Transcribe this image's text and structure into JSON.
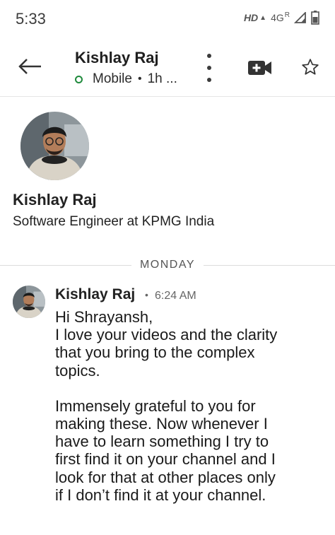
{
  "status_bar": {
    "time": "5:33",
    "network_label": "HD",
    "lte_label": "4G",
    "roaming_label": "R",
    "icons": [
      "signal-icon",
      "battery-icon"
    ]
  },
  "header": {
    "contact_name": "Kishlay Raj",
    "presence_status": "Mobile",
    "last_active": "1h ...",
    "presence_color": "#1f8a3c"
  },
  "profile": {
    "name": "Kishlay Raj",
    "headline": "Software Engineer at KPMG India"
  },
  "day_separator": "MONDAY",
  "message": {
    "sender": "Kishlay Raj",
    "time": "6:24 AM",
    "lines": [
      "Hi Shrayansh,",
      "I love your videos and the clarity",
      "that you bring to the complex",
      "topics.",
      "",
      "Immensely grateful to you for",
      "making these. Now whenever I",
      "have to learn something I try to",
      "first find it on your channel and I",
      "look for that at other places only",
      "if I don’t find it at your channel."
    ]
  }
}
